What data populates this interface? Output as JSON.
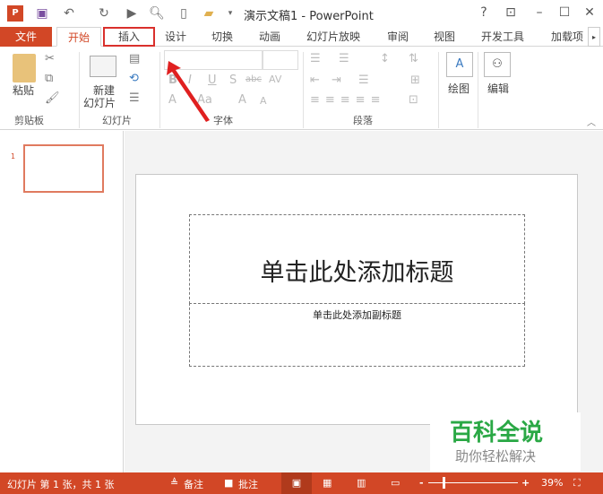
{
  "window": {
    "title": "演示文稿1 - PowerPoint",
    "help": "?",
    "ribbon_display": "⊡",
    "minimize": "–",
    "maximize": "☐",
    "close": "✕"
  },
  "tabs": [
    "文件",
    "开始",
    "插入",
    "设计",
    "切换",
    "动画",
    "幻灯片放映",
    "审阅",
    "视图",
    "开发工具",
    "加载项"
  ],
  "ribbon": {
    "paste": "粘贴",
    "new_slide_1": "新建",
    "new_slide_2": "幻灯片",
    "draw": "绘图",
    "edit": "编辑",
    "groups": [
      "剪贴板",
      "幻灯片",
      "字体",
      "段落"
    ]
  },
  "thumb_number": "1",
  "slide": {
    "title_placeholder": "单击此处添加标题",
    "subtitle_placeholder": "单击此处添加副标题"
  },
  "status": {
    "slide_info": "幻灯片 第 1 张，共 1 张",
    "notes": "备注",
    "comments": "批注",
    "zoom": "39%",
    "zoom_minus": "-",
    "zoom_plus": "+"
  },
  "watermark": {
    "line1": "百科全说",
    "line2": "助你轻松解决"
  },
  "colors": {
    "accent": "#d24726",
    "highlight": "#d9302c"
  }
}
